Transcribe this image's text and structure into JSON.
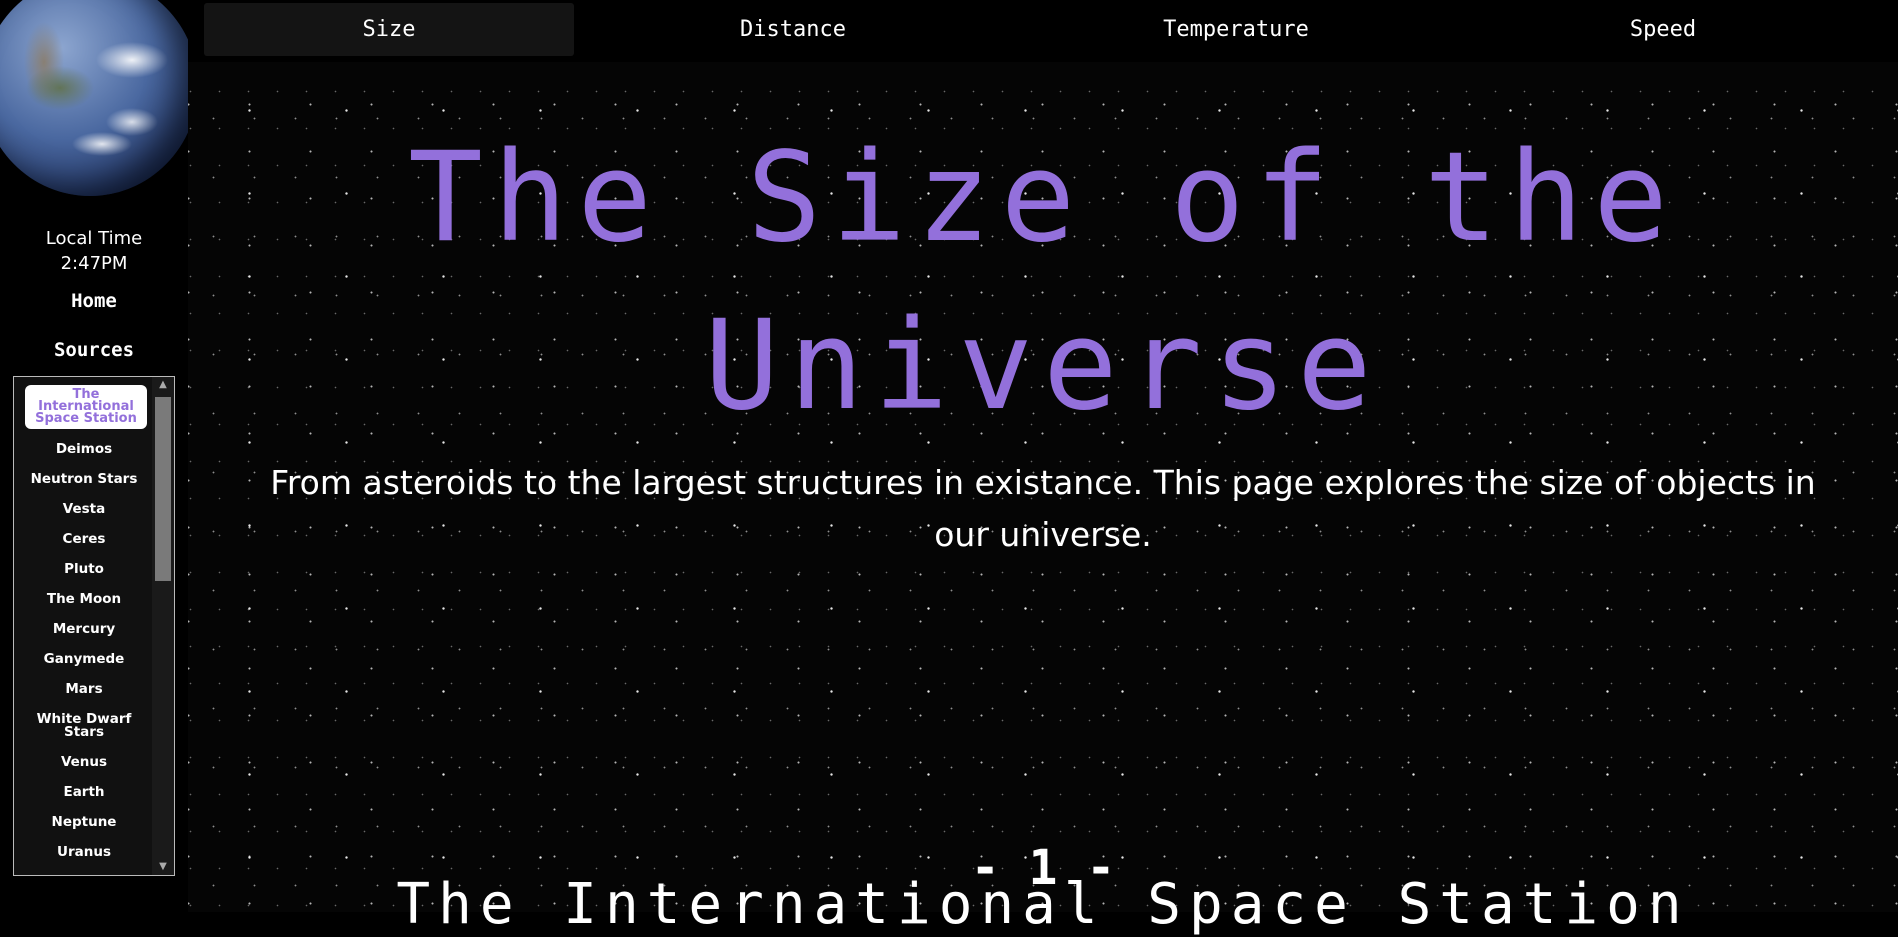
{
  "sidebar": {
    "local_time_label": "Local Time",
    "local_time_value": "2:47PM",
    "home_label": "Home",
    "sources_label": "Sources",
    "objects": [
      "The International Space Station",
      "Deimos",
      "Neutron Stars",
      "Vesta",
      "Ceres",
      "Pluto",
      "The Moon",
      "Mercury",
      "Ganymede",
      "Mars",
      "White Dwarf Stars",
      "Venus",
      "Earth",
      "Neptune",
      "Uranus"
    ],
    "active_index": 0
  },
  "tabs": [
    {
      "label": "Size",
      "active": true
    },
    {
      "label": "Distance",
      "active": false
    },
    {
      "label": "Temperature",
      "active": false
    },
    {
      "label": "Speed",
      "active": false
    }
  ],
  "hero": {
    "title": "The Size of the Universe",
    "subtitle": "From asteroids to the largest structures in existance. This page explores the size of objects in our universe."
  },
  "section": {
    "number": "- 1 -",
    "title": "The International Space Station"
  },
  "colors": {
    "accent": "#9370db",
    "background": "#000000",
    "text": "#ffffff"
  }
}
